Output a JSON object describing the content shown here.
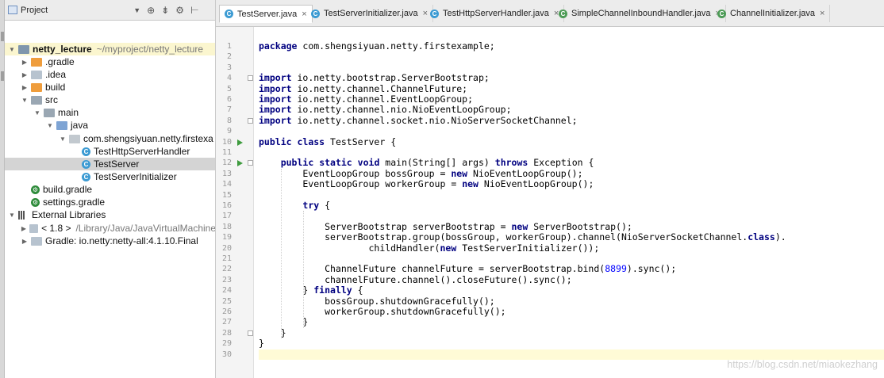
{
  "project_panel": {
    "title": "Project",
    "tree": [
      {
        "label": "netty_lecture",
        "suffix": "~/myproject/netty_lecture",
        "icon": "module-folder-icon",
        "arrow": "▼",
        "depth": 0
      },
      {
        "label": ".gradle",
        "icon": "folder-icon",
        "arrow": "▶",
        "depth": 1
      },
      {
        "label": ".idea",
        "icon": "folder-icon",
        "arrow": "▶",
        "depth": 1
      },
      {
        "label": "build",
        "icon": "folder-icon",
        "arrow": "▶",
        "depth": 1
      },
      {
        "label": "src",
        "icon": "folder-icon",
        "arrow": "▼",
        "depth": 1
      },
      {
        "label": "main",
        "icon": "folder-icon",
        "arrow": "▼",
        "depth": 2
      },
      {
        "label": "java",
        "icon": "folder-icon",
        "arrow": "▼",
        "depth": 3
      },
      {
        "label": "com.shengsiyuan.netty.firstexa",
        "icon": "package-icon",
        "arrow": "▼",
        "depth": 4
      },
      {
        "label": "TestHttpServerHandler",
        "icon": "class-icon",
        "depth": 5
      },
      {
        "label": "TestServer",
        "icon": "class-icon",
        "depth": 5
      },
      {
        "label": "TestServerInitializer",
        "icon": "class-icon",
        "depth": 5
      },
      {
        "label": "build.gradle",
        "icon": "gradle-icon",
        "depth": 1
      },
      {
        "label": "settings.gradle",
        "icon": "gradle-icon",
        "depth": 1
      },
      {
        "label": "External Libraries",
        "icon": "library-icon",
        "arrow": "▼",
        "depth": 0
      },
      {
        "label": "< 1.8 >",
        "suffix": "/Library/Java/JavaVirtualMachine",
        "icon": "jdk-icon",
        "arrow": "▶",
        "depth": 1
      },
      {
        "label": "Gradle: io.netty:netty-all:4.1.10.Final",
        "icon": "jar-icon",
        "arrow": "▶",
        "depth": 1
      }
    ]
  },
  "tabs": [
    {
      "label": "TestServer.java",
      "active": true
    },
    {
      "label": "TestServerInitializer.java"
    },
    {
      "label": "TestHttpServerHandler.java"
    },
    {
      "label": "SimpleChannelInboundHandler.java"
    },
    {
      "label": "ChannelInitializer.java"
    }
  ],
  "editor": {
    "line_numbers": [
      "1",
      "2",
      "3",
      "4",
      "5",
      "6",
      "7",
      "8",
      "9",
      "10",
      "11",
      "12",
      "13",
      "14",
      "15",
      "16",
      "17",
      "18",
      "19",
      "20",
      "21",
      "22",
      "23",
      "24",
      "25",
      "26",
      "27",
      "28",
      "29",
      "30"
    ],
    "lines": [
      "package com.shengsiyuan.netty.firstexample;",
      "",
      "",
      "import io.netty.bootstrap.ServerBootstrap;",
      "import io.netty.channel.ChannelFuture;",
      "import io.netty.channel.EventLoopGroup;",
      "import io.netty.channel.nio.NioEventLoopGroup;",
      "import io.netty.channel.socket.nio.NioServerSocketChannel;",
      "",
      "public class TestServer {",
      "",
      "    public static void main(String[] args) throws Exception {",
      "        EventLoopGroup bossGroup = new NioEventLoopGroup();",
      "        EventLoopGroup workerGroup = new NioEventLoopGroup();",
      "",
      "        try {",
      "",
      "            ServerBootstrap serverBootstrap = new ServerBootstrap();",
      "            serverBootstrap.group(bossGroup, workerGroup).channel(NioServerSocketChannel.class).",
      "                    childHandler(new TestServerInitializer());",
      "",
      "            ChannelFuture channelFuture = serverBootstrap.bind(8899).sync();",
      "            channelFuture.channel().closeFuture().sync();",
      "        } finally {",
      "            bossGroup.shutdownGracefully();",
      "            workerGroup.shutdownGracefully();",
      "        }",
      "    }",
      "}",
      ""
    ],
    "keywords": [
      "package",
      "import",
      "public",
      "class",
      "static",
      "void",
      "throws",
      "new",
      "try",
      "finally"
    ]
  },
  "watermark": "https://blog.csdn.net/miaokezhang",
  "colors": {
    "keyword": "#000080",
    "number": "#0000ff",
    "selection": "#d4d4d4",
    "caret_line": "#fffbd6"
  }
}
